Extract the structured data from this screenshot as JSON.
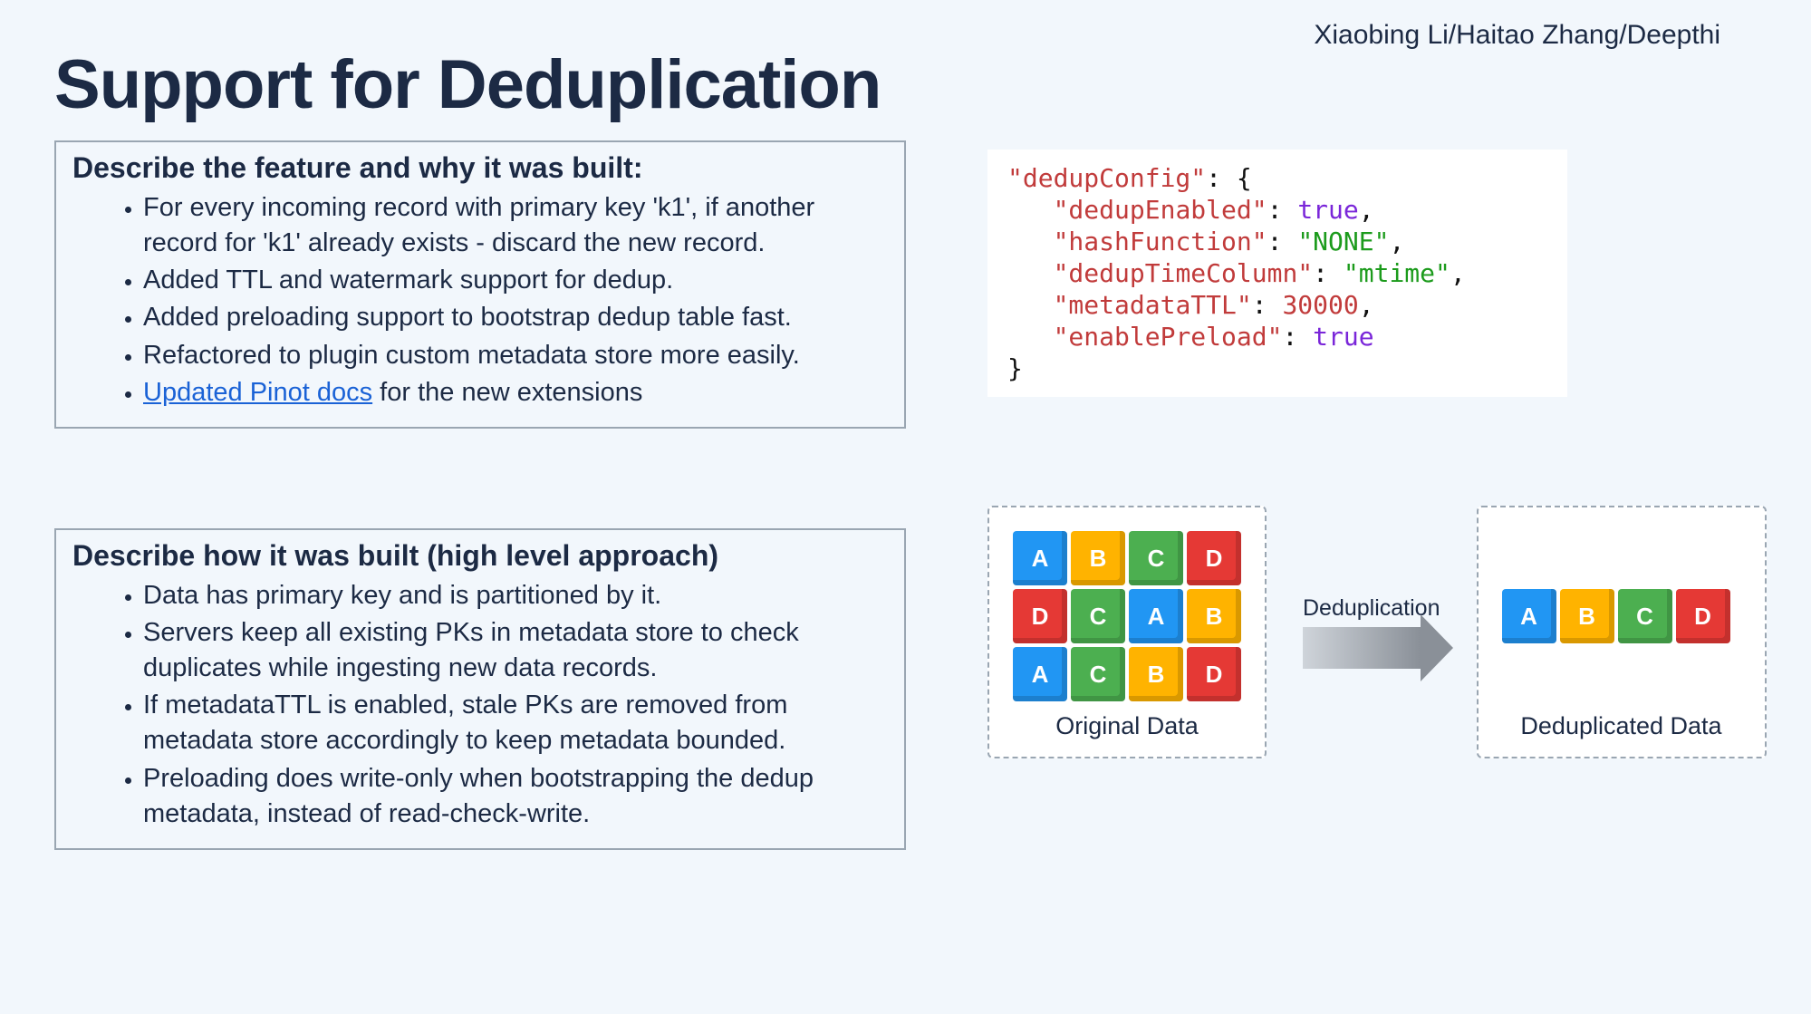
{
  "authors": "Xiaobing Li/Haitao Zhang/Deepthi",
  "title": "Support for Deduplication",
  "box1": {
    "heading": "Describe the feature and why it was built:",
    "items": [
      "For every incoming record with primary key 'k1', if another record for 'k1' already exists - discard the new record.",
      "Added TTL and watermark support for dedup.",
      "Added preloading support to bootstrap dedup table fast.",
      "Refactored to plugin custom metadata store more easily."
    ],
    "link_text": "Updated Pinot docs",
    "link_suffix": " for the new extensions"
  },
  "box2": {
    "heading": "Describe how it was built (high level approach)",
    "items": [
      "Data has primary key and is partitioned by it.",
      "Servers keep all existing PKs in metadata store to check duplicates while ingesting new data records.",
      "If metadataTTL is enabled, stale PKs are removed from metadata store accordingly to keep metadata bounded.",
      "Preloading does write-only when bootstrapping the dedup metadata, instead of read-check-write."
    ]
  },
  "code": {
    "k_root": "\"dedupConfig\"",
    "k1": "\"dedupEnabled\"",
    "v1": "true",
    "k2": "\"hashFunction\"",
    "v2": "\"NONE\"",
    "k3": "\"dedupTimeColumn\"",
    "v3": "\"mtime\"",
    "k4": "\"metadataTTL\"",
    "v4": "30000",
    "k5": "\"enablePreload\"",
    "v5": "true"
  },
  "diagram": {
    "arrow_label": "Deduplication",
    "orig_label": "Original Data",
    "dedup_label": "Deduplicated Data",
    "orig_rows": [
      [
        "A",
        "B",
        "C",
        "D"
      ],
      [
        "D",
        "C",
        "A",
        "B"
      ],
      [
        "A",
        "C",
        "B",
        "D"
      ]
    ],
    "dedup_row": [
      "A",
      "B",
      "C",
      "D"
    ]
  }
}
